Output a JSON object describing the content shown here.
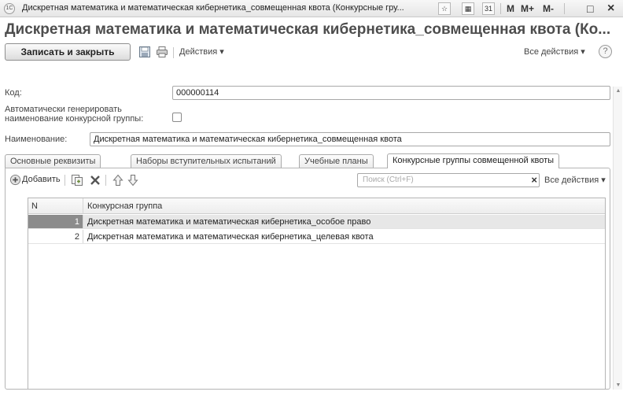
{
  "window": {
    "app_icon": "1c-app-icon",
    "app_icon_text": "1C",
    "title": "Дискретная математика и математическая кибернетика_совмещенная квота (Конкурсные гру...",
    "buttons": {
      "star_icon": "☆",
      "grid_icon": "▦",
      "calendar_icon": "31",
      "m": "M",
      "m_plus": "M+",
      "m_minus": "M-",
      "maximize_icon": "□",
      "close_icon": "×"
    }
  },
  "form": {
    "title": "Дискретная математика и математическая кибернетика_совмещенная квота (Ко..."
  },
  "toolbar": {
    "save_close": "Записать и закрыть",
    "actions": "Действия ▾",
    "all_actions": "Все действия ▾",
    "help": "?"
  },
  "fields": {
    "code_label": "Код:",
    "code_value": "000000114",
    "auto_label_line1": "Автоматически генерировать",
    "auto_label_line2": "наименование конкурсной группы:",
    "auto_checked": false,
    "name_label": "Наименование:",
    "name_value": "Дискретная математика и математическая кибернетика_совмещенная квота"
  },
  "tabs": [
    {
      "label": "Основные реквизиты"
    },
    {
      "label": "Наборы вступительных испытаний"
    },
    {
      "label": "Учебные планы"
    },
    {
      "label": "Конкурсные группы совмещенной квоты",
      "active": true
    }
  ],
  "grid_toolbar": {
    "add": "Добавить",
    "search_placeholder": "Поиск (Ctrl+F)",
    "clear": "×",
    "all_actions": "Все действия ▾"
  },
  "table": {
    "columns": [
      "N",
      "Конкурсная группа"
    ],
    "rows": [
      {
        "n": "1",
        "group": "Дискретная математика и математическая кибернетика_особое право",
        "selected": true
      },
      {
        "n": "2",
        "group": "Дискретная математика и математическая кибернетика_целевая квота",
        "selected": false
      }
    ]
  },
  "colors": {
    "accent": "#4d4d4d",
    "selection": "#8c8c8c"
  }
}
